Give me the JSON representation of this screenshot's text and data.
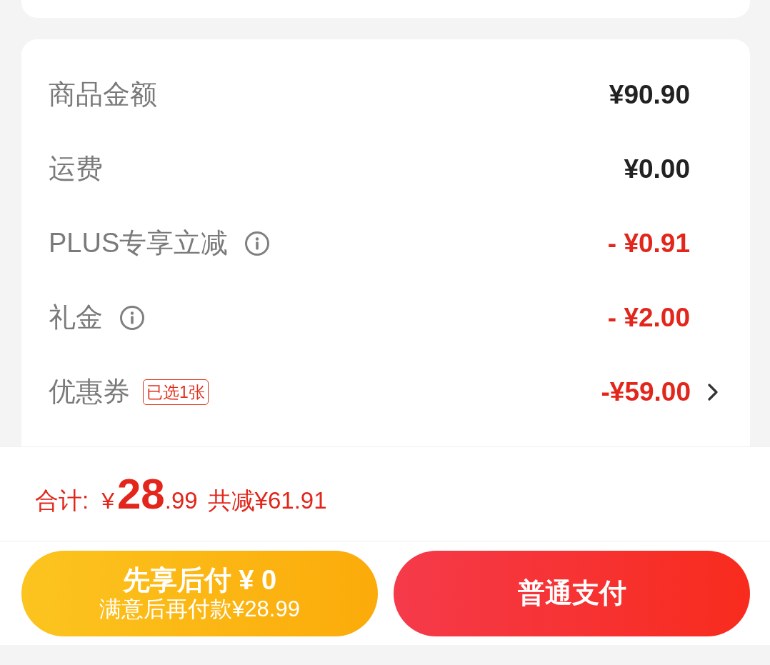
{
  "summary_rows": [
    {
      "label": "商品金额",
      "value": "¥90.90",
      "kind": "amount",
      "info": false,
      "chevron": false
    },
    {
      "label": "运费",
      "value": "¥0.00",
      "kind": "amount",
      "info": false,
      "chevron": false
    },
    {
      "label": "PLUS专享立减",
      "value": "- ¥0.91",
      "kind": "deduction",
      "info": true,
      "chevron": false
    },
    {
      "label": "礼金",
      "value": "- ¥2.00",
      "kind": "deduction",
      "info": true,
      "chevron": false
    },
    {
      "label": "优惠券",
      "badge": "已选1张",
      "value": "-¥59.00",
      "kind": "deduction",
      "info": false,
      "chevron": true
    }
  ],
  "total": {
    "label": "合计:",
    "currency": "¥",
    "integer": "28",
    "decimal": ".99",
    "savings": "共减¥61.91"
  },
  "buttons": [
    {
      "kind": "pay_later",
      "title": "先享后付 ¥ 0",
      "subtitle": "满意后再付款¥28.99"
    },
    {
      "kind": "pay_now",
      "title": "普通支付"
    }
  ]
}
